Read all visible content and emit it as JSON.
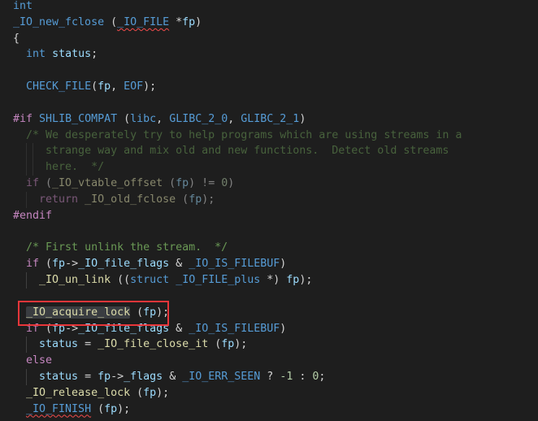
{
  "editor": {
    "theme_colors": {
      "background": "#1e1e1e",
      "keyword": "#569cd6",
      "control": "#c586c0",
      "function": "#dcdcaa",
      "variable": "#9cdcfe",
      "comment": "#6a9955",
      "number": "#b5cea8",
      "annotation_box": "#e8363a"
    },
    "highlighted_line": 19,
    "lines": [
      {
        "indent": 0,
        "tokens": [
          [
            "int",
            "kw"
          ]
        ]
      },
      {
        "indent": 0,
        "tokens": [
          [
            "_IO_new_fclose",
            "mac"
          ],
          [
            " (",
            "pl"
          ],
          [
            "_IO_FILE",
            "mac squig"
          ],
          [
            " *",
            "pl"
          ],
          [
            "fp",
            "var"
          ],
          [
            ")",
            "pl"
          ]
        ]
      },
      {
        "indent": 0,
        "tokens": [
          [
            "{",
            "pl"
          ]
        ]
      },
      {
        "indent": 1,
        "tokens": [
          [
            "int",
            "kw"
          ],
          [
            " ",
            "pl"
          ],
          [
            "status",
            "var"
          ],
          [
            ";",
            "pl"
          ]
        ]
      },
      {
        "indent": 0,
        "tokens": []
      },
      {
        "indent": 1,
        "tokens": [
          [
            "CHECK_FILE",
            "mac"
          ],
          [
            "(",
            "pl"
          ],
          [
            "fp",
            "var"
          ],
          [
            ", ",
            "pl"
          ],
          [
            "EOF",
            "mac"
          ],
          [
            ");",
            "pl"
          ]
        ]
      },
      {
        "indent": 0,
        "tokens": []
      },
      {
        "indent": 0,
        "tokens": [
          [
            "#if",
            "pp"
          ],
          [
            " ",
            "pl"
          ],
          [
            "SHLIB_COMPAT",
            "mac"
          ],
          [
            " (",
            "pl"
          ],
          [
            "libc",
            "mac"
          ],
          [
            ", ",
            "pl"
          ],
          [
            "GLIBC_2_0",
            "mac"
          ],
          [
            ", ",
            "pl"
          ],
          [
            "GLIBC_2_1",
            "mac"
          ],
          [
            ")",
            "pl"
          ]
        ]
      },
      {
        "indent": 1,
        "inactive": true,
        "tokens": [
          [
            "/* We desperately try to help programs which are using streams in a",
            "cm"
          ]
        ]
      },
      {
        "indent": 1,
        "inactive": true,
        "guides": [
          2,
          3
        ],
        "tokens": [
          [
            "   strange way and mix old and new functions.  Detect old streams",
            "cm"
          ]
        ]
      },
      {
        "indent": 1,
        "inactive": true,
        "guides": [
          2,
          3
        ],
        "tokens": [
          [
            "   here.  */",
            "cm"
          ]
        ]
      },
      {
        "indent": 1,
        "inactive": true,
        "tokens": [
          [
            "if",
            "ctl"
          ],
          [
            " (",
            "pl"
          ],
          [
            "_IO_vtable_offset",
            "fn"
          ],
          [
            " (",
            "pl"
          ],
          [
            "fp",
            "var"
          ],
          [
            ") != ",
            "pl"
          ],
          [
            "0",
            "num"
          ],
          [
            ")",
            "pl"
          ]
        ]
      },
      {
        "indent": 2,
        "inactive": true,
        "guides": [
          2
        ],
        "tokens": [
          [
            "return",
            "ctl"
          ],
          [
            " ",
            "pl"
          ],
          [
            "_IO_old_fclose",
            "fn"
          ],
          [
            " (",
            "pl"
          ],
          [
            "fp",
            "var"
          ],
          [
            ");",
            "pl"
          ]
        ]
      },
      {
        "indent": 0,
        "tokens": [
          [
            "#endif",
            "pp"
          ]
        ]
      },
      {
        "indent": 0,
        "tokens": []
      },
      {
        "indent": 1,
        "tokens": [
          [
            "/* First unlink the stream.  */",
            "cm"
          ]
        ]
      },
      {
        "indent": 1,
        "tokens": [
          [
            "if",
            "ctl"
          ],
          [
            " (",
            "pl"
          ],
          [
            "fp",
            "var"
          ],
          [
            "->",
            "pl"
          ],
          [
            "_IO_file_flags",
            "var"
          ],
          [
            " & ",
            "pl"
          ],
          [
            "_IO_IS_FILEBUF",
            "mac"
          ],
          [
            ")",
            "pl"
          ]
        ]
      },
      {
        "indent": 2,
        "guides": [
          2
        ],
        "tokens": [
          [
            "_IO_un_link",
            "fn"
          ],
          [
            " ((",
            "pl"
          ],
          [
            "struct",
            "kw"
          ],
          [
            " ",
            "pl"
          ],
          [
            "_IO_FILE_plus",
            "mac"
          ],
          [
            " *) ",
            "pl"
          ],
          [
            "fp",
            "var"
          ],
          [
            ");",
            "pl"
          ]
        ]
      },
      {
        "indent": 0,
        "tokens": []
      },
      {
        "indent": 1,
        "tokens": [
          [
            "_IO_acquire_lock",
            "fn hl"
          ],
          [
            " (",
            "pl"
          ],
          [
            "fp",
            "var"
          ],
          [
            ");",
            "pl"
          ]
        ]
      },
      {
        "indent": 1,
        "tokens": [
          [
            "if",
            "ctl"
          ],
          [
            " (",
            "pl"
          ],
          [
            "fp",
            "var"
          ],
          [
            "->",
            "pl"
          ],
          [
            "_IO_file_flags",
            "var"
          ],
          [
            " & ",
            "pl"
          ],
          [
            "_IO_IS_FILEBUF",
            "mac"
          ],
          [
            ")",
            "pl"
          ]
        ]
      },
      {
        "indent": 2,
        "guides": [
          2
        ],
        "tokens": [
          [
            "status",
            "var"
          ],
          [
            " = ",
            "pl"
          ],
          [
            "_IO_file_close_it",
            "fn"
          ],
          [
            " (",
            "pl"
          ],
          [
            "fp",
            "var"
          ],
          [
            ");",
            "pl"
          ]
        ]
      },
      {
        "indent": 1,
        "tokens": [
          [
            "else",
            "ctl"
          ]
        ]
      },
      {
        "indent": 2,
        "guides": [
          2
        ],
        "tokens": [
          [
            "status",
            "var"
          ],
          [
            " = ",
            "pl"
          ],
          [
            "fp",
            "var"
          ],
          [
            "->",
            "pl"
          ],
          [
            "_flags",
            "var"
          ],
          [
            " & ",
            "pl"
          ],
          [
            "_IO_ERR_SEEN",
            "mac"
          ],
          [
            " ? ",
            "pl"
          ],
          [
            "-1",
            "num"
          ],
          [
            " : ",
            "pl"
          ],
          [
            "0",
            "num"
          ],
          [
            ";",
            "pl"
          ]
        ]
      },
      {
        "indent": 1,
        "tokens": [
          [
            "_IO_release_lock",
            "fn"
          ],
          [
            " (",
            "pl"
          ],
          [
            "fp",
            "var"
          ],
          [
            ");",
            "pl"
          ]
        ]
      },
      {
        "indent": 1,
        "tokens": [
          [
            "_IO_FINISH",
            "mac squig"
          ],
          [
            " (",
            "pl"
          ],
          [
            "fp",
            "var"
          ],
          [
            ");",
            "pl"
          ]
        ]
      }
    ]
  }
}
